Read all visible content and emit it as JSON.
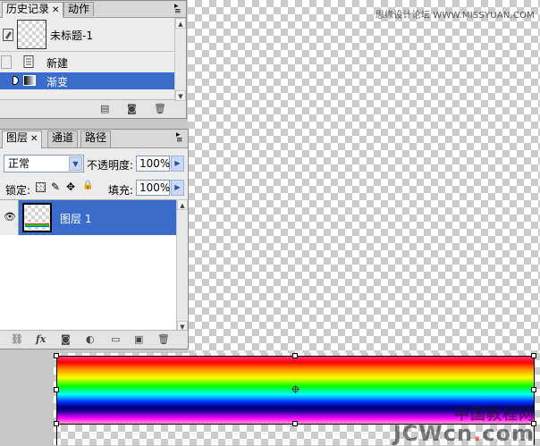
{
  "watermark": "思缘设计论坛 WWW.MISSYUAN.COM",
  "logo": {
    "cn": "中国教程网",
    "en": "JCWcn",
    "dot": ".",
    "tld": "com"
  },
  "history_panel": {
    "tabs": [
      {
        "label": "历史记录"
      },
      {
        "label": "动作"
      }
    ],
    "snapshot_label": "未标题-1",
    "items": [
      {
        "label": "新建"
      },
      {
        "label": "渐变"
      }
    ]
  },
  "layers_panel": {
    "tabs": [
      {
        "label": "图层"
      },
      {
        "label": "通道"
      },
      {
        "label": "路径"
      }
    ],
    "blend_mode": "正常",
    "opacity_label": "不透明度:",
    "opacity_value": "100%",
    "lock_label": "锁定:",
    "fill_label": "填充:",
    "fill_value": "100%",
    "layers": [
      {
        "name": "图层 1"
      }
    ],
    "footer_icons": [
      "link-icon",
      "fx-icon",
      "mask-icon",
      "adjustment-icon",
      "group-icon",
      "new-layer-icon",
      "trash-icon"
    ]
  },
  "colors": {
    "selection": "#3a6ccb",
    "panel": "#ececec",
    "input_border": "#7f9db9"
  }
}
